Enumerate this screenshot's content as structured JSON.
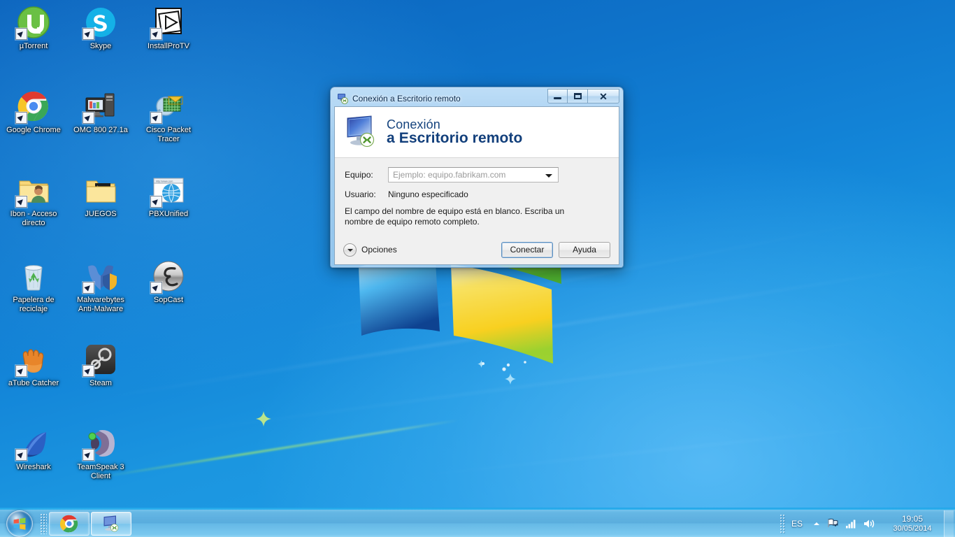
{
  "desktop": {
    "wallpaper_name": "windows-7-harmony-wallpaper",
    "background_colors": {
      "top": "#0b63bd",
      "mid": "#1385d8",
      "bottom": "#2aa3e8"
    },
    "icons": [
      {
        "label": "µTorrent",
        "name": "desktop-icon-utorrent",
        "icon": "utorrent-icon",
        "shortcut": true
      },
      {
        "label": "Skype",
        "name": "desktop-icon-skype",
        "icon": "skype-icon",
        "shortcut": true
      },
      {
        "label": "InstallProTV",
        "name": "desktop-icon-installprotv",
        "icon": "installprotv-icon",
        "shortcut": true
      },
      {
        "label": "Google Chrome",
        "name": "desktop-icon-google-chrome",
        "icon": "chrome-icon",
        "shortcut": true
      },
      {
        "label": "OMC 800 27.1a",
        "name": "desktop-icon-omc-800",
        "icon": "computer-icon",
        "shortcut": true
      },
      {
        "label": "Cisco Packet Tracer",
        "name": "desktop-icon-cisco-packet-tracer",
        "icon": "packet-tracer-icon",
        "shortcut": true
      },
      {
        "label": "Ibon - Acceso directo",
        "name": "desktop-icon-ibon",
        "icon": "user-folder-icon",
        "shortcut": true
      },
      {
        "label": "JUEGOS",
        "name": "desktop-icon-juegos",
        "icon": "folder-icon",
        "shortcut": false
      },
      {
        "label": "PBXUnified",
        "name": "desktop-icon-pbxunified",
        "icon": "web-shortcut-icon",
        "shortcut": true
      },
      {
        "label": "Papelera de reciclaje",
        "name": "desktop-icon-recycle-bin",
        "icon": "recycle-bin-icon",
        "shortcut": false
      },
      {
        "label": "Malwarebytes Anti-Malware",
        "name": "desktop-icon-malwarebytes",
        "icon": "malwarebytes-icon",
        "shortcut": true
      },
      {
        "label": "SopCast",
        "name": "desktop-icon-sopcast",
        "icon": "sopcast-icon",
        "shortcut": true
      },
      {
        "label": "aTube Catcher",
        "name": "desktop-icon-atube-catcher",
        "icon": "atube-catcher-icon",
        "shortcut": true
      },
      {
        "label": "Steam",
        "name": "desktop-icon-steam",
        "icon": "steam-icon",
        "shortcut": true
      },
      {
        "label": "Wireshark",
        "name": "desktop-icon-wireshark",
        "icon": "wireshark-icon",
        "shortcut": true
      },
      {
        "label": "TeamSpeak 3 Client",
        "name": "desktop-icon-teamspeak-3",
        "icon": "teamspeak-icon",
        "shortcut": true
      }
    ]
  },
  "rdp_dialog": {
    "title": "Conexión a Escritorio remoto",
    "title_icon": "remote-desktop-icon",
    "window_controls": {
      "minimize": "—",
      "maximize": "□",
      "close": "✕"
    },
    "banner": {
      "icon": "remote-desktop-monitor-icon",
      "heading_line1": "Conexión",
      "heading_line2": "a Escritorio remoto",
      "heading_color": "#16447e"
    },
    "form": {
      "computer_label": "Equipo:",
      "computer_placeholder": "Ejemplo: equipo.fabrikam.com",
      "computer_value": "",
      "user_label": "Usuario:",
      "user_value": "Ninguno especificado",
      "hint": "El campo del nombre de equipo está en blanco. Escriba un nombre de equipo remoto completo."
    },
    "footer": {
      "options_label": "Opciones",
      "options_icon": "chevron-down-icon",
      "connect_label": "Conectar",
      "help_label": "Ayuda"
    }
  },
  "taskbar": {
    "start_label": "Inicio",
    "start_icon": "windows-start-orb-icon",
    "buttons": [
      {
        "name": "taskbar-button-chrome",
        "icon": "chrome-icon",
        "label": "Google Chrome",
        "active": false
      },
      {
        "name": "taskbar-button-rdp",
        "icon": "remote-desktop-icon",
        "label": "Conexión a Escritorio remoto",
        "active": true
      }
    ],
    "tray": {
      "language": "ES",
      "show_hidden_icon": "chevron-up-icon",
      "action_center_icon": "action-center-flag-icon",
      "network_icon": "network-signal-icon",
      "volume_icon": "volume-speaker-icon",
      "time": "19:05",
      "date": "30/05/2014",
      "show_desktop_label": "Mostrar escritorio"
    }
  }
}
